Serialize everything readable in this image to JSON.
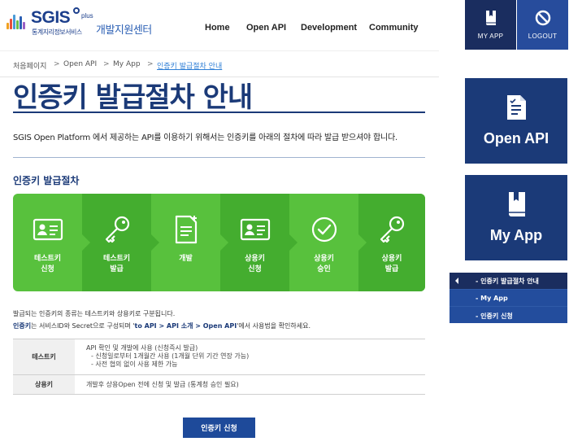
{
  "header": {
    "logo_brand": "SGIS",
    "logo_plus": "plus",
    "logo_sub": "통계지리정보서비스",
    "center_title": "개발지원센터",
    "nav": [
      "Home",
      "Open API",
      "Development",
      "Community"
    ],
    "my_app_label": "MY APP",
    "logout_label": "LOGOUT"
  },
  "breadcrumb": {
    "items": [
      "처음페이지",
      "Open API",
      "My App",
      "인증키 발급절차 안내"
    ],
    "separator": ">"
  },
  "main": {
    "title": "인증키 발급절차 안내",
    "intro": "SGIS Open Platform 에서 제공하는 API를 이용하기 위해서는 인증키를 아래의 절차에 따라 발급 받으셔야 합니다.",
    "section_title": "인증키 발급절차",
    "steps": [
      {
        "label": "테스트키\n신청",
        "icon": "id-card-icon"
      },
      {
        "label": "테스트키\n발급",
        "icon": "key-icon"
      },
      {
        "label": "개발",
        "icon": "document-edit-icon"
      },
      {
        "label": "상용키\n신청",
        "icon": "id-card-icon"
      },
      {
        "label": "상용키\n승인",
        "icon": "check-circle-icon"
      },
      {
        "label": "상용키\n발급",
        "icon": "key-icon"
      }
    ],
    "note1": "발급되는 인증키의 종류는 테스트키와 상용키로 구분됩니다.",
    "note2_key": "인증키",
    "note2_mid": "는 서비스ID와 Secret으로 구성되며 '",
    "note2_link": "to API > API 소개 > Open API",
    "note2_end": "'에서 사용법을 확인하세요.",
    "table": {
      "rows": [
        {
          "header": "테스트키",
          "lines": [
            "API 확인 및 개발에 사용 (신청즉시 발급)",
            "- 신청일로부터 1개월간 사용 (1개월 단위 기간 연장 가능)",
            "- 사전 협의 없이 사용 제한 가능"
          ]
        },
        {
          "header": "상용키",
          "lines": [
            "개발후 상용Open 전에 신청 및 발급 (통계청 승인 필요)"
          ]
        }
      ]
    },
    "apply_button": "인증키 신청"
  },
  "sidebar": {
    "cards": [
      {
        "label": "Open API",
        "icon": "document-icon"
      },
      {
        "label": "My App",
        "icon": "book-icon"
      }
    ],
    "menu": {
      "active": "- 인증키 발급절차 안내",
      "items": [
        "- My App",
        "- 인증키 신청"
      ]
    }
  },
  "colors": {
    "navy": "#1b3a78",
    "dark_navy": "#1a2d5f",
    "blue": "#274c9c",
    "green": "#58c13d",
    "green_dark": "#44ad2f",
    "link": "#2f7fd6"
  }
}
